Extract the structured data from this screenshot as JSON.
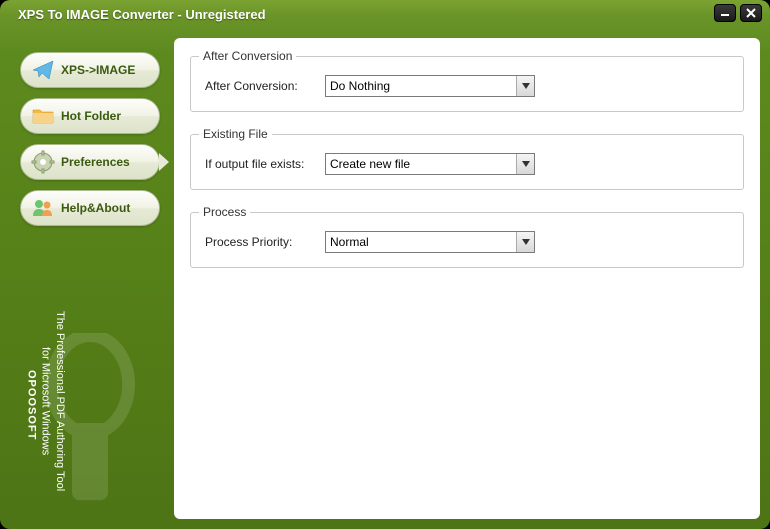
{
  "window": {
    "title": "XPS To IMAGE Converter - Unregistered"
  },
  "sidebar": {
    "items": [
      {
        "label": "XPS->IMAGE"
      },
      {
        "label": "Hot Folder"
      },
      {
        "label": "Preferences"
      },
      {
        "label": "Help&About"
      }
    ],
    "tagline": "The Professional PDF Authoring Tool",
    "tagline2": "for Microsoft Windows",
    "brand": "OPOOSOFT"
  },
  "panels": {
    "afterConversion": {
      "legend": "After Conversion",
      "label": "After Conversion:",
      "value": "Do Nothing"
    },
    "existingFile": {
      "legend": "Existing File",
      "label": "If output file exists:",
      "value": "Create new file"
    },
    "process": {
      "legend": "Process",
      "label": "Process Priority:",
      "value": "Normal"
    }
  }
}
